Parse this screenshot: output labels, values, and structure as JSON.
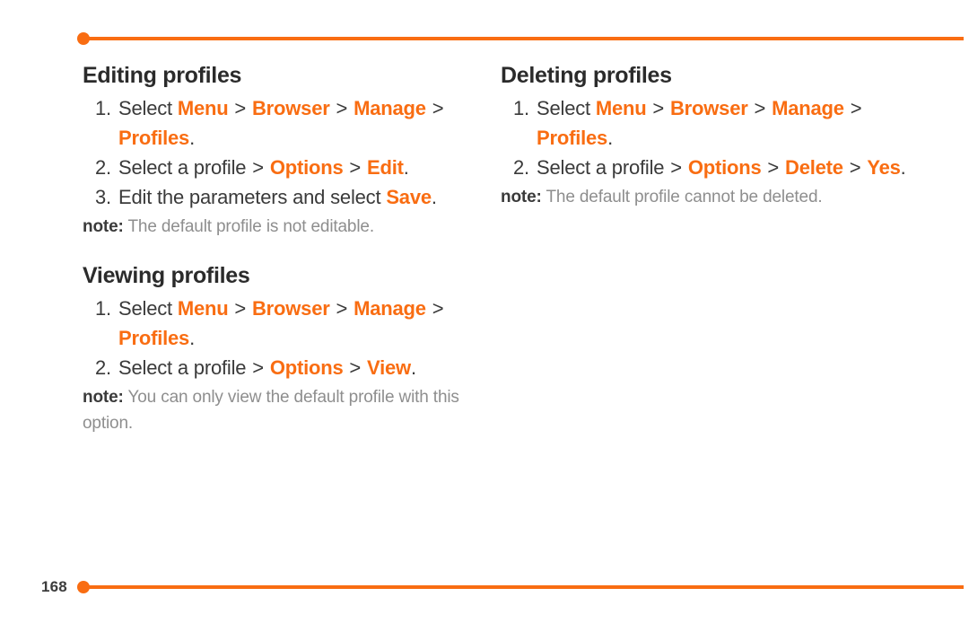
{
  "page": {
    "number": "168",
    "accent_color": "#f96d12",
    "text_color": "#2b2b2b",
    "note_color": "#8e8e8e",
    "background": "#ffffff"
  },
  "columns": {
    "left": [
      {
        "title": "Editing profiles",
        "steps": [
          {
            "num": "1.",
            "parts": [
              {
                "type": "plain",
                "text": "Select "
              },
              {
                "type": "kw",
                "text": "Menu"
              },
              {
                "type": "sep",
                "text": " > "
              },
              {
                "type": "kw",
                "text": "Browser"
              },
              {
                "type": "sep",
                "text": " > "
              },
              {
                "type": "kw",
                "text": "Manage"
              },
              {
                "type": "sep",
                "text": " > "
              },
              {
                "type": "kw",
                "text": "Profiles"
              },
              {
                "type": "plain",
                "text": "."
              }
            ]
          },
          {
            "num": "2.",
            "parts": [
              {
                "type": "plain",
                "text": "Select a profile "
              },
              {
                "type": "sep",
                "text": "> "
              },
              {
                "type": "kw",
                "text": "Options"
              },
              {
                "type": "sep",
                "text": " > "
              },
              {
                "type": "kw",
                "text": "Edit"
              },
              {
                "type": "plain",
                "text": "."
              }
            ]
          },
          {
            "num": "3.",
            "parts": [
              {
                "type": "plain",
                "text": "Edit the parameters and select "
              },
              {
                "type": "kw",
                "text": "Save"
              },
              {
                "type": "plain",
                "text": "."
              }
            ]
          }
        ],
        "note_label": "note:",
        "note_text": " The default profile is not editable."
      },
      {
        "title": "Viewing profiles",
        "steps": [
          {
            "num": "1.",
            "parts": [
              {
                "type": "plain",
                "text": "Select "
              },
              {
                "type": "kw",
                "text": "Menu"
              },
              {
                "type": "sep",
                "text": " > "
              },
              {
                "type": "kw",
                "text": "Browser"
              },
              {
                "type": "sep",
                "text": " > "
              },
              {
                "type": "kw",
                "text": "Manage"
              },
              {
                "type": "sep",
                "text": " > "
              },
              {
                "type": "kw",
                "text": "Profiles"
              },
              {
                "type": "plain",
                "text": "."
              }
            ]
          },
          {
            "num": "2.",
            "parts": [
              {
                "type": "plain",
                "text": "Select a profile "
              },
              {
                "type": "sep",
                "text": "> "
              },
              {
                "type": "kw",
                "text": "Options"
              },
              {
                "type": "sep",
                "text": " > "
              },
              {
                "type": "kw",
                "text": "View"
              },
              {
                "type": "plain",
                "text": "."
              }
            ]
          }
        ],
        "note_label": "note:",
        "note_text": " You can only view the default profile with this option."
      }
    ],
    "right": [
      {
        "title": "Deleting profiles",
        "steps": [
          {
            "num": "1.",
            "parts": [
              {
                "type": "plain",
                "text": "Select "
              },
              {
                "type": "kw",
                "text": "Menu"
              },
              {
                "type": "sep",
                "text": " > "
              },
              {
                "type": "kw",
                "text": "Browser"
              },
              {
                "type": "sep",
                "text": " > "
              },
              {
                "type": "kw",
                "text": "Manage"
              },
              {
                "type": "sep",
                "text": " > "
              },
              {
                "type": "kw",
                "text": "Profiles"
              },
              {
                "type": "plain",
                "text": "."
              }
            ]
          },
          {
            "num": "2.",
            "parts": [
              {
                "type": "plain",
                "text": "Select a profile "
              },
              {
                "type": "sep",
                "text": "> "
              },
              {
                "type": "kw",
                "text": "Options"
              },
              {
                "type": "sep",
                "text": " > "
              },
              {
                "type": "kw",
                "text": "Delete"
              },
              {
                "type": "sep",
                "text": " > "
              },
              {
                "type": "kw",
                "text": "Yes"
              },
              {
                "type": "plain",
                "text": "."
              }
            ]
          }
        ],
        "note_label": "note:",
        "note_text": " The default profile cannot be deleted."
      }
    ]
  }
}
